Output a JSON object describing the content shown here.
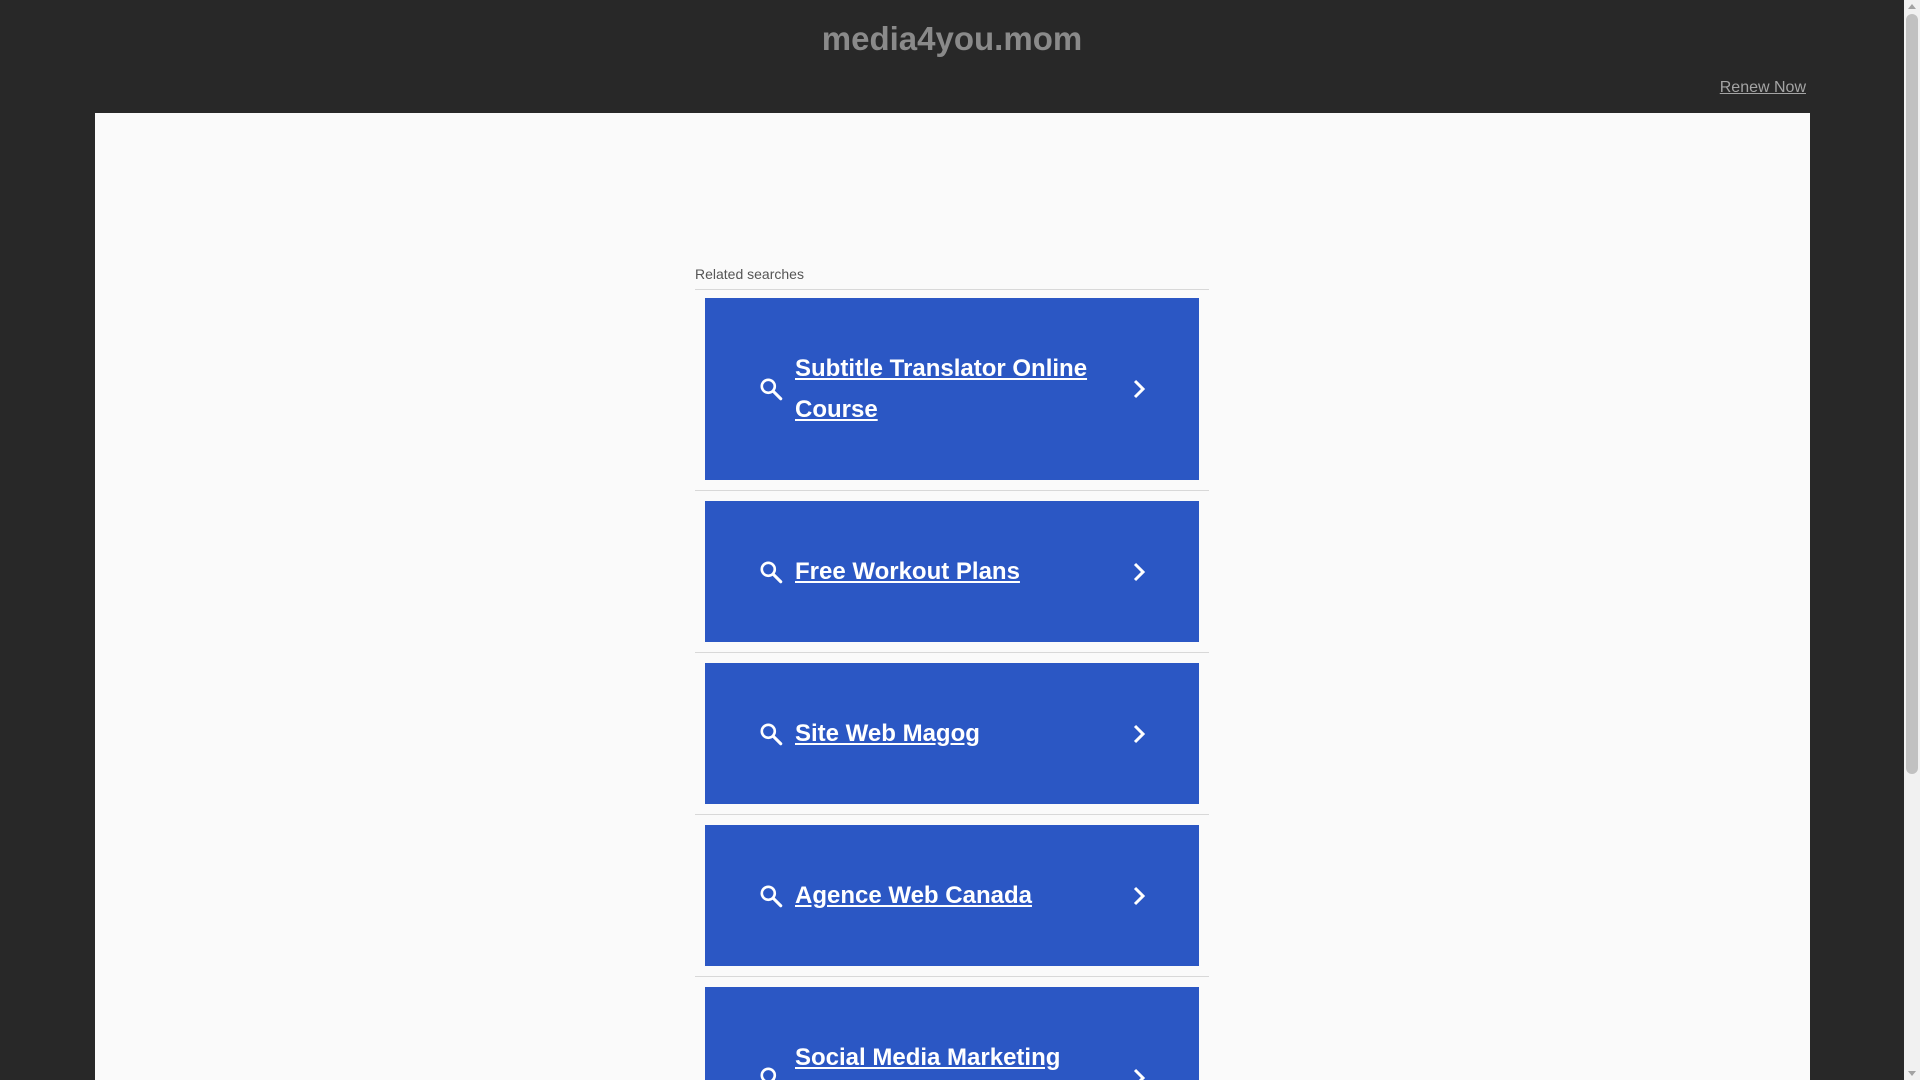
{
  "site": {
    "title": "media4you.mom",
    "renew_label": "Renew Now"
  },
  "related": {
    "header": "Related searches",
    "items": [
      {
        "label": "Subtitle Translator Online Course"
      },
      {
        "label": "Free Workout Plans"
      },
      {
        "label": "Site Web Magog"
      },
      {
        "label": "Agence Web Canada"
      },
      {
        "label": "Social Media Marketing"
      }
    ]
  },
  "colors": {
    "background": "#282828",
    "panel": "#fafafa",
    "card": "#2b57c4",
    "card_text": "#ffffff",
    "title": "#8a8a8a"
  },
  "icons": {
    "search": "search-icon",
    "chevron": "chevron-right-icon"
  }
}
